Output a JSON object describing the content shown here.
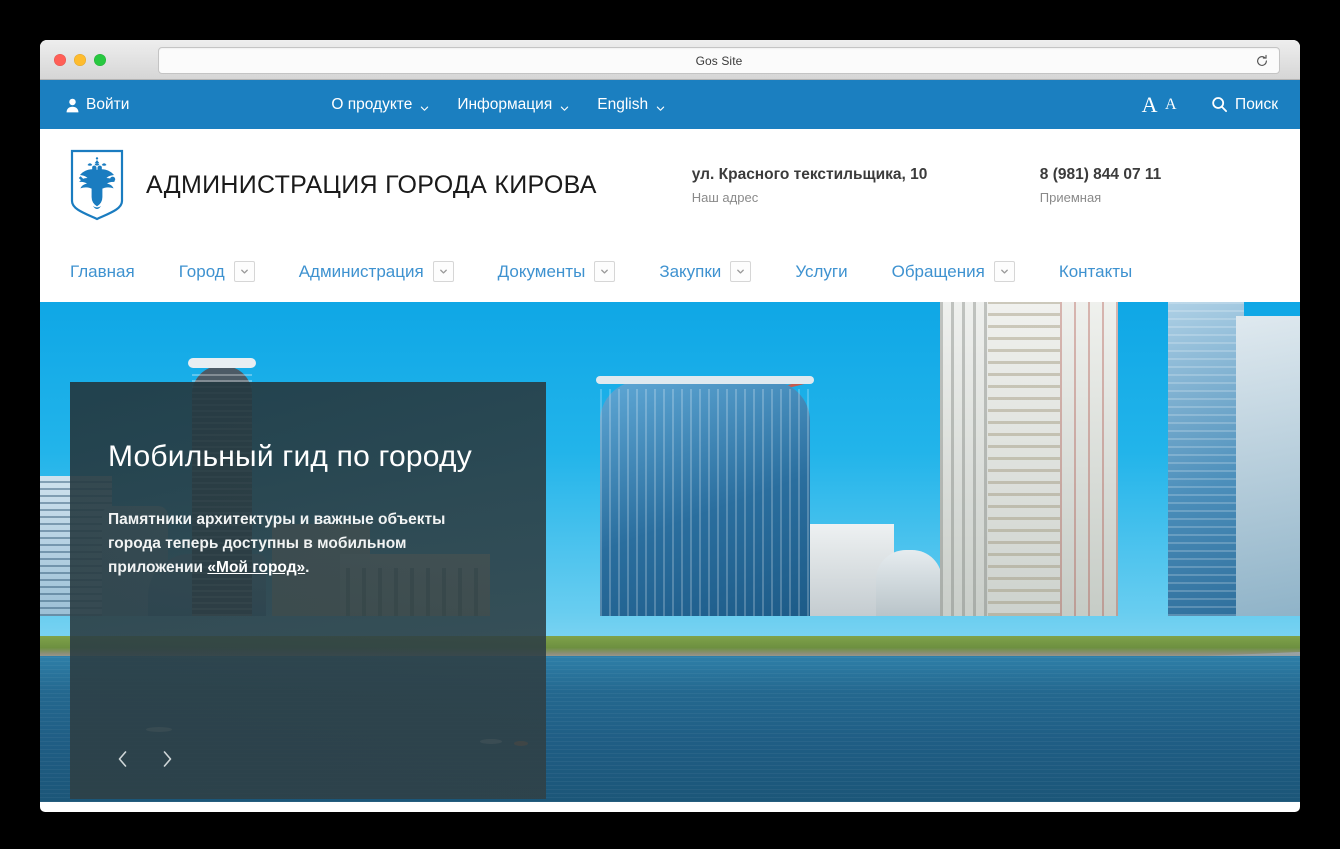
{
  "browser": {
    "page_title": "Gos Site",
    "reload_icon": "reload-icon",
    "traffic_lights": [
      "close",
      "minimize",
      "zoom"
    ]
  },
  "topbar": {
    "login_label": "Войти",
    "login_icon": "person-icon",
    "menu": [
      {
        "label": "О продукте",
        "caret": "chevron-down-icon"
      },
      {
        "label": "Информация",
        "caret": "chevron-down-icon"
      },
      {
        "label": "English",
        "caret": "chevron-down-icon"
      }
    ],
    "font_size_toggle": {
      "big": "A",
      "small": "A"
    },
    "search_label": "Поиск",
    "search_icon": "search-icon",
    "background_color": "#1b7fc0"
  },
  "site_header": {
    "crest_alt": "coat-of-arms-icon",
    "org_title": "АДМИНИСТРАЦИЯ ГОРОДА КИРОВА",
    "contacts": [
      {
        "value": "ул. Красного текстильщика, 10",
        "label": "Наш адрес"
      },
      {
        "value": "8 (981) 844 07 11",
        "label": "Приемная"
      }
    ]
  },
  "main_nav": {
    "link_color": "#3e92d0",
    "items": [
      {
        "label": "Главная",
        "has_dropdown": false
      },
      {
        "label": "Город",
        "has_dropdown": true
      },
      {
        "label": "Администрация",
        "has_dropdown": true
      },
      {
        "label": "Документы",
        "has_dropdown": true
      },
      {
        "label": "Закупки",
        "has_dropdown": true
      },
      {
        "label": "Услуги",
        "has_dropdown": false
      },
      {
        "label": "Обращения",
        "has_dropdown": true
      },
      {
        "label": "Контакты",
        "has_dropdown": false
      }
    ]
  },
  "hero": {
    "title": "Мобильный гид по городу",
    "text_before": "Памятники архитектуры и важные объекты города теперь доступны в мобильном приложении ",
    "link_text": "«Мой город»",
    "text_after": ".",
    "prev_icon": "chevron-left-icon",
    "next_icon": "chevron-right-icon",
    "overlay_color": "#2c3e44"
  }
}
